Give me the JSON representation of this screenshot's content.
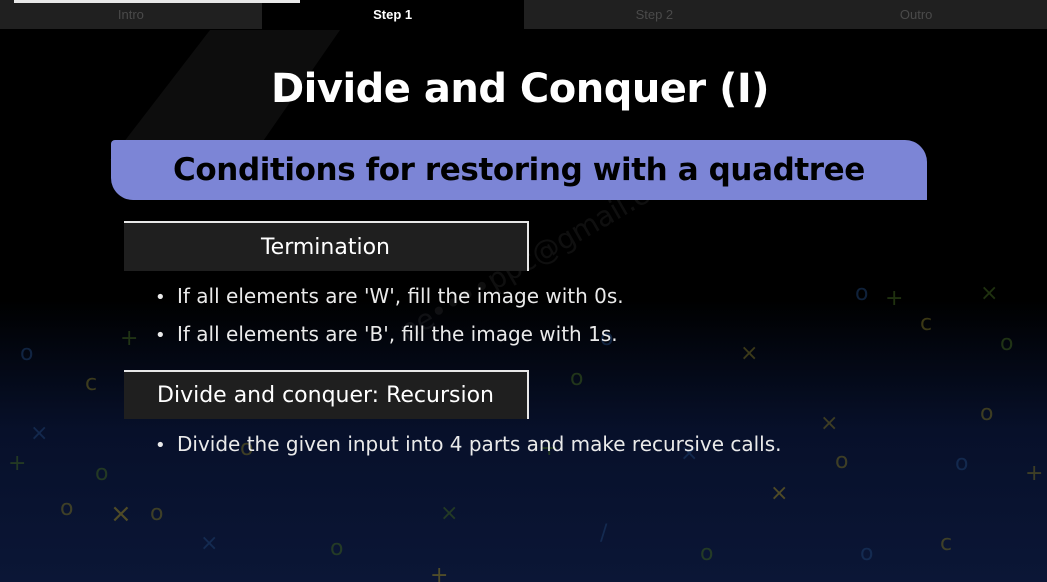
{
  "tabs": [
    {
      "label": "Intro",
      "active": false
    },
    {
      "label": "Step 1",
      "active": true
    },
    {
      "label": "Step 2",
      "active": false
    },
    {
      "label": "Outro",
      "active": false
    }
  ],
  "slide": {
    "title": "Divide and Conquer (I)",
    "subtitle": "Conditions for restoring with a quadtree",
    "sections": [
      {
        "heading": "Termination",
        "bullets": [
          "If all elements are 'W', fill the image with 0s.",
          "If all elements are 'B', fill the image with 1s."
        ]
      },
      {
        "heading": "Divide and conquer: Recursion",
        "bullets": [
          "Divide the given input into 4 parts and make recursive calls."
        ]
      }
    ],
    "bullet_glyph": "•"
  },
  "colors": {
    "banner": "#7c85d6",
    "background": "#000000",
    "symbols_green": "#3a5a1c",
    "symbols_yellow": "#6b6420",
    "symbols_blue": "#1d3d6a"
  }
}
